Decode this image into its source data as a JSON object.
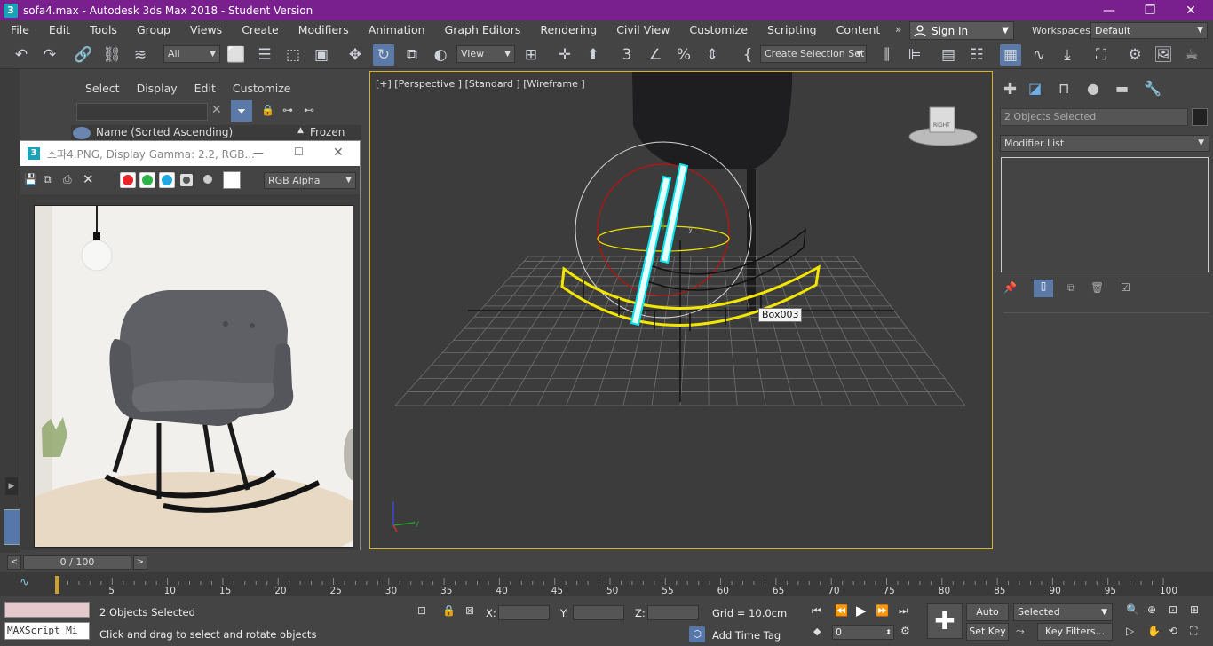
{
  "window": {
    "title": "sofa4.max - Autodesk 3ds Max 2018 - Student Version",
    "icon": "3",
    "minimize": "—",
    "restore": "❐",
    "close": "✕"
  },
  "menubar": {
    "items": [
      "File",
      "Edit",
      "Tools",
      "Group",
      "Views",
      "Create",
      "Modifiers",
      "Animation",
      "Graph Editors",
      "Rendering",
      "Civil View",
      "Customize",
      "Scripting",
      "Content"
    ],
    "overflow": "»",
    "sign_in": "Sign In",
    "workspaces_label": "Workspaces:",
    "workspaces_value": "Default"
  },
  "toolbar": {
    "selection_filter": "All",
    "ref_coord": "View",
    "named_selection": "Create Selection Set",
    "active_tool": "select-and-rotate"
  },
  "scene_explorer": {
    "menu": [
      "Select",
      "Display",
      "Edit",
      "Customize"
    ],
    "col_name": "Name (Sorted Ascending)",
    "sort_arrow": "▲",
    "col_frozen": "Frozen"
  },
  "image_viewer": {
    "title": "소파4.PNG, Display Gamma: 2.2, RGB...",
    "channel": "RGB Alpha",
    "colors": {
      "red": "#e8232a",
      "green": "#2db34a",
      "blue": "#1fa9e0"
    }
  },
  "viewport": {
    "label": "[+] [Perspective ] [Standard ] [Wireframe ]",
    "tooltip": "Box003",
    "viewcube_face": "RIGHT",
    "gizmo_axis": "y",
    "axis_y": "y"
  },
  "command_panel": {
    "selection": "2 Objects Selected",
    "modifier_list": "Modifier List"
  },
  "time_slider": {
    "position": "0 / 100",
    "prev": "<",
    "next": ">",
    "ticks": [
      "5",
      "10",
      "15",
      "20",
      "25",
      "30",
      "35",
      "40",
      "45",
      "50",
      "55",
      "60",
      "65",
      "70",
      "75",
      "80",
      "85",
      "90",
      "95",
      "100"
    ]
  },
  "status": {
    "maxscript": "MAXScript Mi",
    "selected_text": "2 Objects Selected",
    "prompt": "Click and drag to select and rotate objects",
    "x_label": "X:",
    "y_label": "Y:",
    "z_label": "Z:",
    "grid": "Grid = 10.0cm",
    "add_time_tag": "Add Time Tag",
    "auto_key": "Auto Key",
    "set_key": "Set Key",
    "key_mode": "Selected",
    "key_filters": "Key Filters...",
    "frame": "0"
  }
}
